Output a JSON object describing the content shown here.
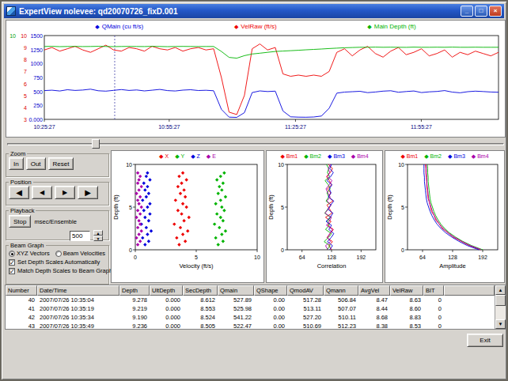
{
  "window": {
    "title": "ExpertView  nolevee: qd20070726_fixD.001"
  },
  "icons": {
    "minimize": "_",
    "maximize": "□",
    "close": "×",
    "up": "▲",
    "down": "▼",
    "check": "✓",
    "diamond": "◆"
  },
  "slider": {
    "position_frac": 0.18
  },
  "controls": {
    "zoom": {
      "title": "Zoom",
      "buttons": [
        "In",
        "Out",
        "Reset"
      ]
    },
    "position": {
      "title": "Position",
      "buttons": [
        "◀",
        "◀",
        "▶",
        "▶"
      ]
    },
    "playback": {
      "title": "Playback",
      "stop_label": "Stop",
      "rate_label": "msec/Ensemble",
      "rate_value": "500"
    },
    "beam_graph": {
      "title": "Beam Graph",
      "radios": [
        {
          "label": "XYZ Vectors",
          "selected": true
        },
        {
          "label": "Beam Velocities",
          "selected": false
        }
      ],
      "checkboxes": [
        {
          "label": "Set Depth Scales Automatically",
          "checked": true
        },
        {
          "label": "Match Depth Scales to Beam Graph",
          "checked": true
        }
      ]
    }
  },
  "table": {
    "columns": [
      "Number",
      "Date/Time",
      "Depth",
      "UltDepth",
      "SecDepth",
      "Qmain",
      "QShape",
      "QmodAV",
      "Qmann",
      "AvgVel",
      "VelRaw",
      "BIT"
    ],
    "rows": [
      [
        "40",
        "2007/07/26 10:35:04",
        "9.278",
        "0.000",
        "8.612",
        "527.89",
        "0.00",
        "517.28",
        "506.84",
        "8.47",
        "8.63",
        "0"
      ],
      [
        "41",
        "2007/07/26 10:35:19",
        "9.219",
        "0.000",
        "8.553",
        "525.98",
        "0.00",
        "513.11",
        "507.07",
        "8.44",
        "8.60",
        "0"
      ],
      [
        "42",
        "2007/07/26 10:35:34",
        "9.190",
        "0.000",
        "8.524",
        "541.22",
        "0.00",
        "527.20",
        "510.11",
        "8.68",
        "8.83",
        "0"
      ],
      [
        "43",
        "2007/07/26 10:35:49",
        "9.236",
        "0.000",
        "8.505",
        "522.47",
        "0.00",
        "510.69",
        "512.23",
        "8.38",
        "8.53",
        "0"
      ]
    ]
  },
  "exit_label": "Exit",
  "chart_data": [
    {
      "id": "main",
      "type": "timeline",
      "plot": {
        "l": 48,
        "t": 4,
        "r": 622,
        "b": 110
      },
      "x_ticks": [
        {
          "label": "10:25:27",
          "frac": 0.0
        },
        {
          "label": "10:55:27",
          "frac": 0.275
        },
        {
          "label": "11:25:27",
          "frac": 0.553
        },
        {
          "label": "11:55:27",
          "frac": 0.83
        }
      ],
      "tick_color": "#000080",
      "cursor_frac": 0.155,
      "y_axes": [
        {
          "color": "#00a000",
          "x": 12,
          "labels": [
            "10"
          ]
        },
        {
          "color": "#dd0000",
          "x": 26,
          "labels": [
            "10",
            "9",
            "8",
            "7",
            "6",
            "5",
            "4",
            "3"
          ]
        },
        {
          "color": "#0000cc",
          "x": 46,
          "labels": [
            "1500",
            "1250",
            "1000",
            "750",
            "500",
            "250",
            "0.000"
          ]
        }
      ],
      "series": [
        {
          "name": "QMain (cu ft/s)",
          "color": "#0000dd",
          "ylim": [
            0,
            1500
          ],
          "values": [
            515,
            522,
            508,
            530,
            518,
            525,
            540,
            512,
            505,
            520,
            533,
            518,
            526,
            510,
            522,
            536,
            515,
            508,
            524,
            530,
            517,
            521,
            512,
            180,
            40,
            35,
            120,
            480,
            510,
            498,
            505,
            150,
            45,
            40,
            38,
            42,
            60,
            200,
            470,
            488,
            495,
            502,
            478,
            490,
            505,
            512,
            486,
            498,
            508,
            480,
            492,
            500,
            515,
            488,
            476,
            495,
            505,
            498,
            490,
            486
          ]
        },
        {
          "name": "VelRaw (ft/s)",
          "color": "#ee0000",
          "ylim": [
            3,
            10
          ],
          "values": [
            8.8,
            9.0,
            8.7,
            8.9,
            9.1,
            8.8,
            8.6,
            8.9,
            9.2,
            8.8,
            8.7,
            9.0,
            8.9,
            8.7,
            9.1,
            8.9,
            8.8,
            9.0,
            8.7,
            8.9,
            9.0,
            8.8,
            8.9,
            6.5,
            3.6,
            3.4,
            5.0,
            8.9,
            9.3,
            8.8,
            9.0,
            6.8,
            6.6,
            6.7,
            6.6,
            6.7,
            6.6,
            7.0,
            8.6,
            8.9,
            8.3,
            8.8,
            9.1,
            8.5,
            8.2,
            8.7,
            9.0,
            8.4,
            8.6,
            8.9,
            8.3,
            8.5,
            8.8,
            8.2,
            8.6,
            8.4,
            8.7,
            8.5,
            8.3,
            8.6
          ]
        },
        {
          "name": "Main Depth (ft)",
          "color": "#00b400",
          "ylim": [
            0,
            10
          ],
          "values": [
            8.7,
            8.72,
            8.68,
            8.7,
            8.71,
            8.69,
            8.7,
            8.72,
            8.7,
            8.68,
            8.7,
            8.71,
            8.7,
            8.69,
            8.72,
            8.7,
            8.68,
            8.7,
            8.71,
            8.7,
            8.69,
            8.7,
            8.7,
            8.1,
            7.4,
            7.3,
            7.6,
            7.8,
            7.9,
            8.0,
            8.1,
            8.15,
            8.2,
            8.25,
            8.3,
            8.35,
            8.4,
            8.45,
            8.5,
            8.55,
            8.58,
            8.6,
            8.6,
            8.62,
            8.6,
            8.61,
            8.6,
            8.59,
            8.62,
            8.6,
            8.6,
            8.61,
            8.6,
            8.62,
            8.6,
            8.6,
            8.61,
            8.6,
            8.6,
            8.6
          ]
        }
      ]
    },
    {
      "id": "xyz",
      "type": "scatter",
      "plot": {
        "l": 30,
        "t": 4,
        "r": 184,
        "b": 112
      },
      "xlim": [
        0,
        10
      ],
      "ylim": [
        0,
        10
      ],
      "x_ticks": [
        {
          "label": "0",
          "v": 0
        },
        {
          "label": "5",
          "v": 5
        },
        {
          "label": "10",
          "v": 10
        }
      ],
      "y_ticks": [
        {
          "label": "0",
          "v": 0
        },
        {
          "label": "5",
          "v": 5
        },
        {
          "label": "10",
          "v": 10
        }
      ],
      "xlabel": "Velocity (ft/s)",
      "ylabel": "Depth (ft)",
      "depths": [
        0.6,
        1.0,
        1.4,
        1.8,
        2.2,
        2.6,
        3.0,
        3.4,
        3.8,
        4.2,
        4.6,
        5.0,
        5.4,
        5.8,
        6.2,
        6.6,
        7.0,
        7.4,
        7.8,
        8.2,
        8.6,
        9.0
      ],
      "series": [
        {
          "name": "X",
          "color": "#ee0000",
          "values": [
            3.6,
            4.1,
            3.4,
            3.9,
            4.3,
            3.7,
            3.2,
            4.0,
            4.4,
            3.8,
            3.5,
            4.2,
            3.9,
            3.3,
            4.1,
            3.7,
            4.0,
            3.5,
            3.8,
            4.2,
            3.6,
            3.9
          ]
        },
        {
          "name": "Y",
          "color": "#00b400",
          "values": [
            6.8,
            7.2,
            6.6,
            7.1,
            7.4,
            6.9,
            6.5,
            7.2,
            7.0,
            6.7,
            7.3,
            7.1,
            6.6,
            7.0,
            7.4,
            6.8,
            7.1,
            6.9,
            7.2,
            6.7,
            7.0,
            7.3
          ]
        },
        {
          "name": "Z",
          "color": "#0000dd",
          "values": [
            0.8,
            1.1,
            0.6,
            1.0,
            1.3,
            0.9,
            0.5,
            1.1,
            0.8,
            1.2,
            0.7,
            1.0,
            1.2,
            0.6,
            0.9,
            1.1,
            0.8,
            1.0,
            0.7,
            1.2,
            0.9,
            1.0
          ]
        },
        {
          "name": "E",
          "color": "#aa00aa",
          "values": [
            0.2,
            0.4,
            0.1,
            0.3,
            0.5,
            0.2,
            0.4,
            0.3,
            0.1,
            0.4,
            0.2,
            0.5,
            0.3,
            0.2,
            0.4,
            0.1,
            0.3,
            0.5,
            0.2,
            0.3,
            0.4,
            0.2
          ]
        }
      ]
    },
    {
      "id": "corr",
      "type": "profile",
      "plot": {
        "l": 26,
        "t": 4,
        "r": 138,
        "b": 112
      },
      "xlim": [
        32,
        224
      ],
      "ylim": [
        0,
        10
      ],
      "x_ticks": [
        {
          "label": "64",
          "v": 64
        },
        {
          "label": "128",
          "v": 128
        },
        {
          "label": "192",
          "v": 192
        }
      ],
      "y_ticks": [
        {
          "label": "0",
          "v": 0
        },
        {
          "label": "5",
          "v": 5
        },
        {
          "label": "10",
          "v": 10
        }
      ],
      "xlabel": "Correlation",
      "ylabel": "Depth (ft)",
      "depths": [
        0,
        0.48,
        0.95,
        1.43,
        1.9,
        2.38,
        2.86,
        3.33,
        3.81,
        4.29,
        4.76,
        5.24,
        5.71,
        6.19,
        6.67,
        7.14,
        7.62,
        8.1,
        8.57,
        9.05,
        9.52,
        10
      ],
      "series": [
        {
          "name": "Bm1",
          "color": "#ee0000",
          "values": [
            128,
            122,
            130,
            118,
            125,
            132,
            120,
            127,
            115,
            129,
            124,
            118,
            131,
            122,
            126,
            119,
            128,
            123,
            117,
            125,
            130,
            121
          ]
        },
        {
          "name": "Bm2",
          "color": "#00b400",
          "values": [
            118,
            125,
            112,
            121,
            128,
            115,
            123,
            119,
            126,
            113,
            120,
            127,
            116,
            122,
            118,
            125,
            121,
            114,
            124,
            119,
            122,
            117
          ]
        },
        {
          "name": "Bm3",
          "color": "#0000dd",
          "values": [
            124,
            130,
            119,
            127,
            133,
            122,
            128,
            116,
            125,
            131,
            120,
            126,
            133,
            121,
            127,
            123,
            129,
            118,
            126,
            132,
            124,
            128
          ]
        },
        {
          "name": "Bm4",
          "color": "#aa00aa",
          "values": [
            120,
            115,
            126,
            119,
            124,
            130,
            117,
            123,
            128,
            114,
            121,
            127,
            118,
            125,
            120,
            116,
            123,
            129,
            119,
            124,
            121,
            126
          ]
        }
      ]
    },
    {
      "id": "amp",
      "type": "profile",
      "plot": {
        "l": 28,
        "t": 4,
        "r": 142,
        "b": 112
      },
      "xlim": [
        32,
        224
      ],
      "ylim": [
        0,
        10
      ],
      "x_ticks": [
        {
          "label": "64",
          "v": 64
        },
        {
          "label": "128",
          "v": 128
        },
        {
          "label": "192",
          "v": 192
        }
      ],
      "y_ticks": [
        {
          "label": "0",
          "v": 0
        },
        {
          "label": "5",
          "v": 5
        },
        {
          "label": "10",
          "v": 10
        }
      ],
      "xlabel": "Amplitude",
      "ylabel": "Depth (ft)",
      "depths": [
        0,
        0.5,
        1,
        1.5,
        2,
        2.5,
        3,
        3.5,
        4,
        4.5,
        5,
        5.5,
        6,
        6.5,
        7,
        7.5,
        8,
        8.5,
        9,
        9.5,
        10
      ],
      "series": [
        {
          "name": "Bm1",
          "color": "#ee0000",
          "values": [
            188,
            163,
            146,
            129,
            118,
            106,
            100,
            92,
            89,
            83,
            81,
            79,
            76,
            75,
            74,
            73,
            73,
            72,
            71,
            71,
            70
          ]
        },
        {
          "name": "Bm2",
          "color": "#00b400",
          "values": [
            192,
            168,
            149,
            134,
            121,
            111,
            103,
            97,
            92,
            88,
            85,
            82,
            80,
            79,
            78,
            77,
            76,
            76,
            75,
            75,
            74
          ]
        },
        {
          "name": "Bm3",
          "color": "#0000dd",
          "values": [
            184,
            159,
            141,
            126,
            113,
            103,
            95,
            89,
            84,
            80,
            77,
            74,
            72,
            71,
            70,
            69,
            68,
            68,
            67,
            67,
            67
          ]
        },
        {
          "name": "Bm4",
          "color": "#aa00aa",
          "values": [
            189,
            165,
            147,
            131,
            118,
            108,
            100,
            94,
            89,
            85,
            82,
            79,
            77,
            76,
            75,
            74,
            73,
            73,
            72,
            72,
            72
          ]
        }
      ]
    }
  ]
}
